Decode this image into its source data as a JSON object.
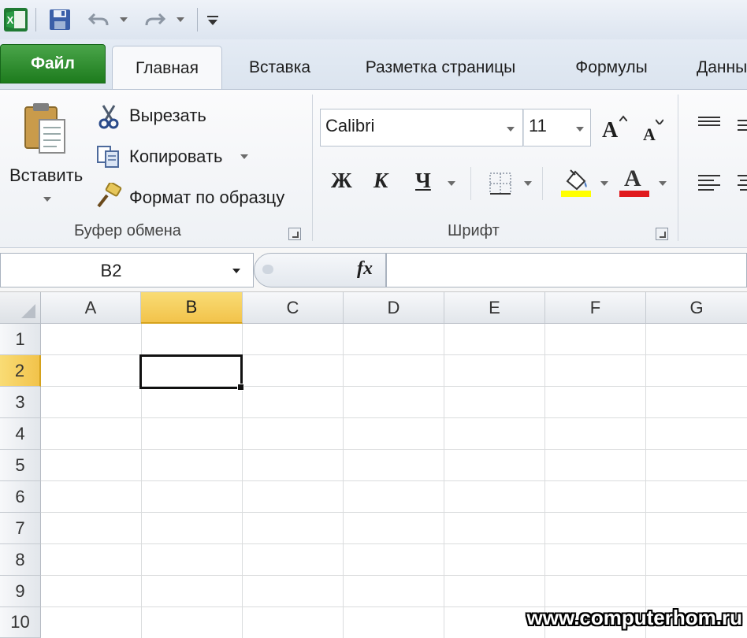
{
  "tabs": {
    "file": "Файл",
    "home": "Главная",
    "insert": "Вставка",
    "page_layout": "Разметка страницы",
    "formulas": "Формулы",
    "data": "Данны"
  },
  "clipboard": {
    "paste": "Вставить",
    "cut": "Вырезать",
    "copy": "Копировать",
    "format_painter": "Формат по образцу",
    "group_label": "Буфер обмена"
  },
  "font": {
    "name": "Calibri",
    "size": "11",
    "bold": "Ж",
    "italic": "К",
    "underline": "Ч",
    "grow_glyph": "A",
    "shrink_glyph": "A",
    "color_glyph": "A",
    "group_label": "Шрифт",
    "highlight_color": "#ffff00",
    "font_color": "#e0191d"
  },
  "formula_bar": {
    "name_box": "B2",
    "fx": "fx",
    "value": ""
  },
  "sheet": {
    "columns": [
      "A",
      "B",
      "C",
      "D",
      "E",
      "F",
      "G"
    ],
    "rows": [
      "1",
      "2",
      "3",
      "4",
      "5",
      "6",
      "7",
      "8",
      "9",
      "10"
    ],
    "active_cell": "B2",
    "active_column": "B",
    "active_row": "2"
  },
  "watermark": "www.computerhom.ru",
  "colors": {
    "file_tab": "#2e8b2e",
    "selection_header": "#f6ce5b"
  }
}
